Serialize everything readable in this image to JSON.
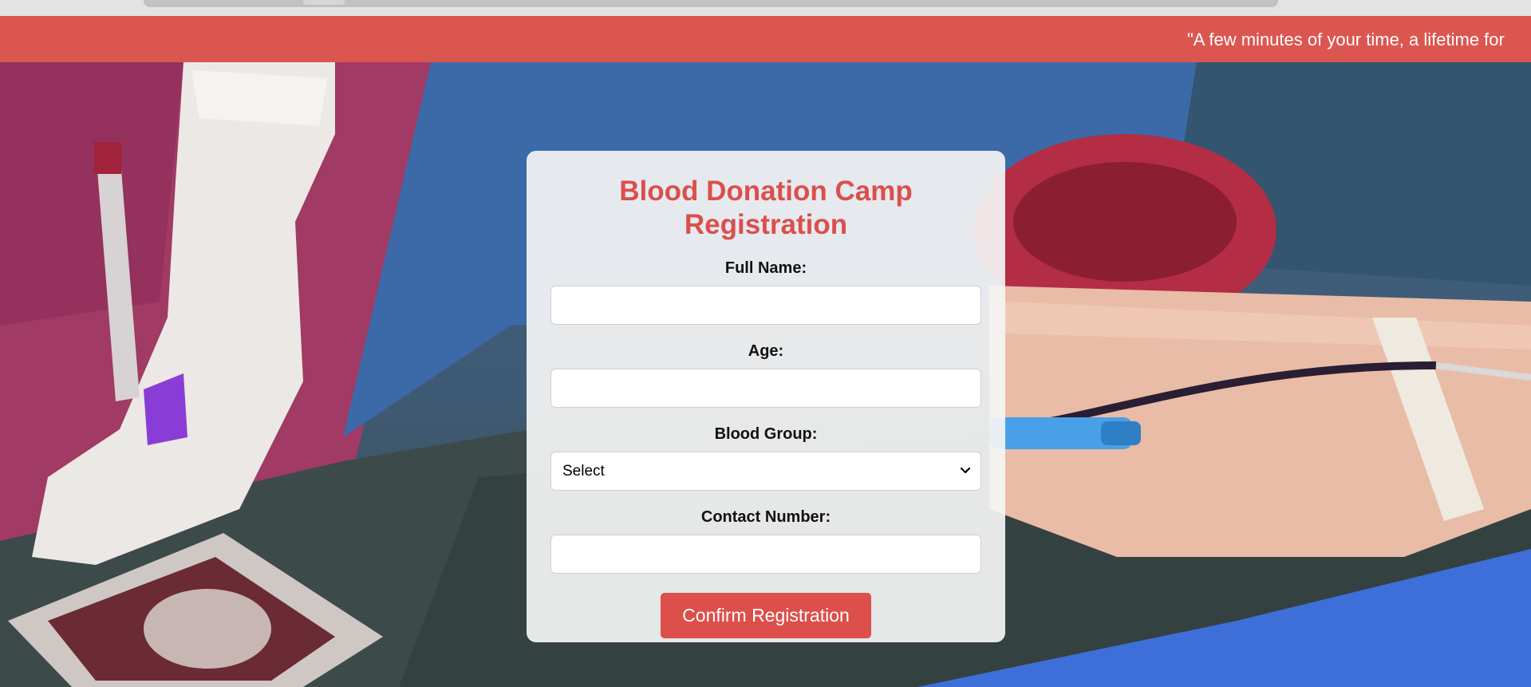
{
  "banner": {
    "text": "\"A few minutes of your time, a lifetime for"
  },
  "form": {
    "title": "Blood Donation Camp Registration",
    "fields": [
      {
        "label": "Full Name:",
        "value": ""
      },
      {
        "label": "Age:",
        "value": ""
      },
      {
        "label": "Blood Group:",
        "value": "Select"
      },
      {
        "label": "Contact Number:",
        "value": ""
      }
    ],
    "submit_label": "Confirm Registration"
  },
  "colors": {
    "accent": "#dc4f4b",
    "banner": "#dc5650"
  },
  "icons": {
    "select_arrow": "chevron-down-icon"
  }
}
